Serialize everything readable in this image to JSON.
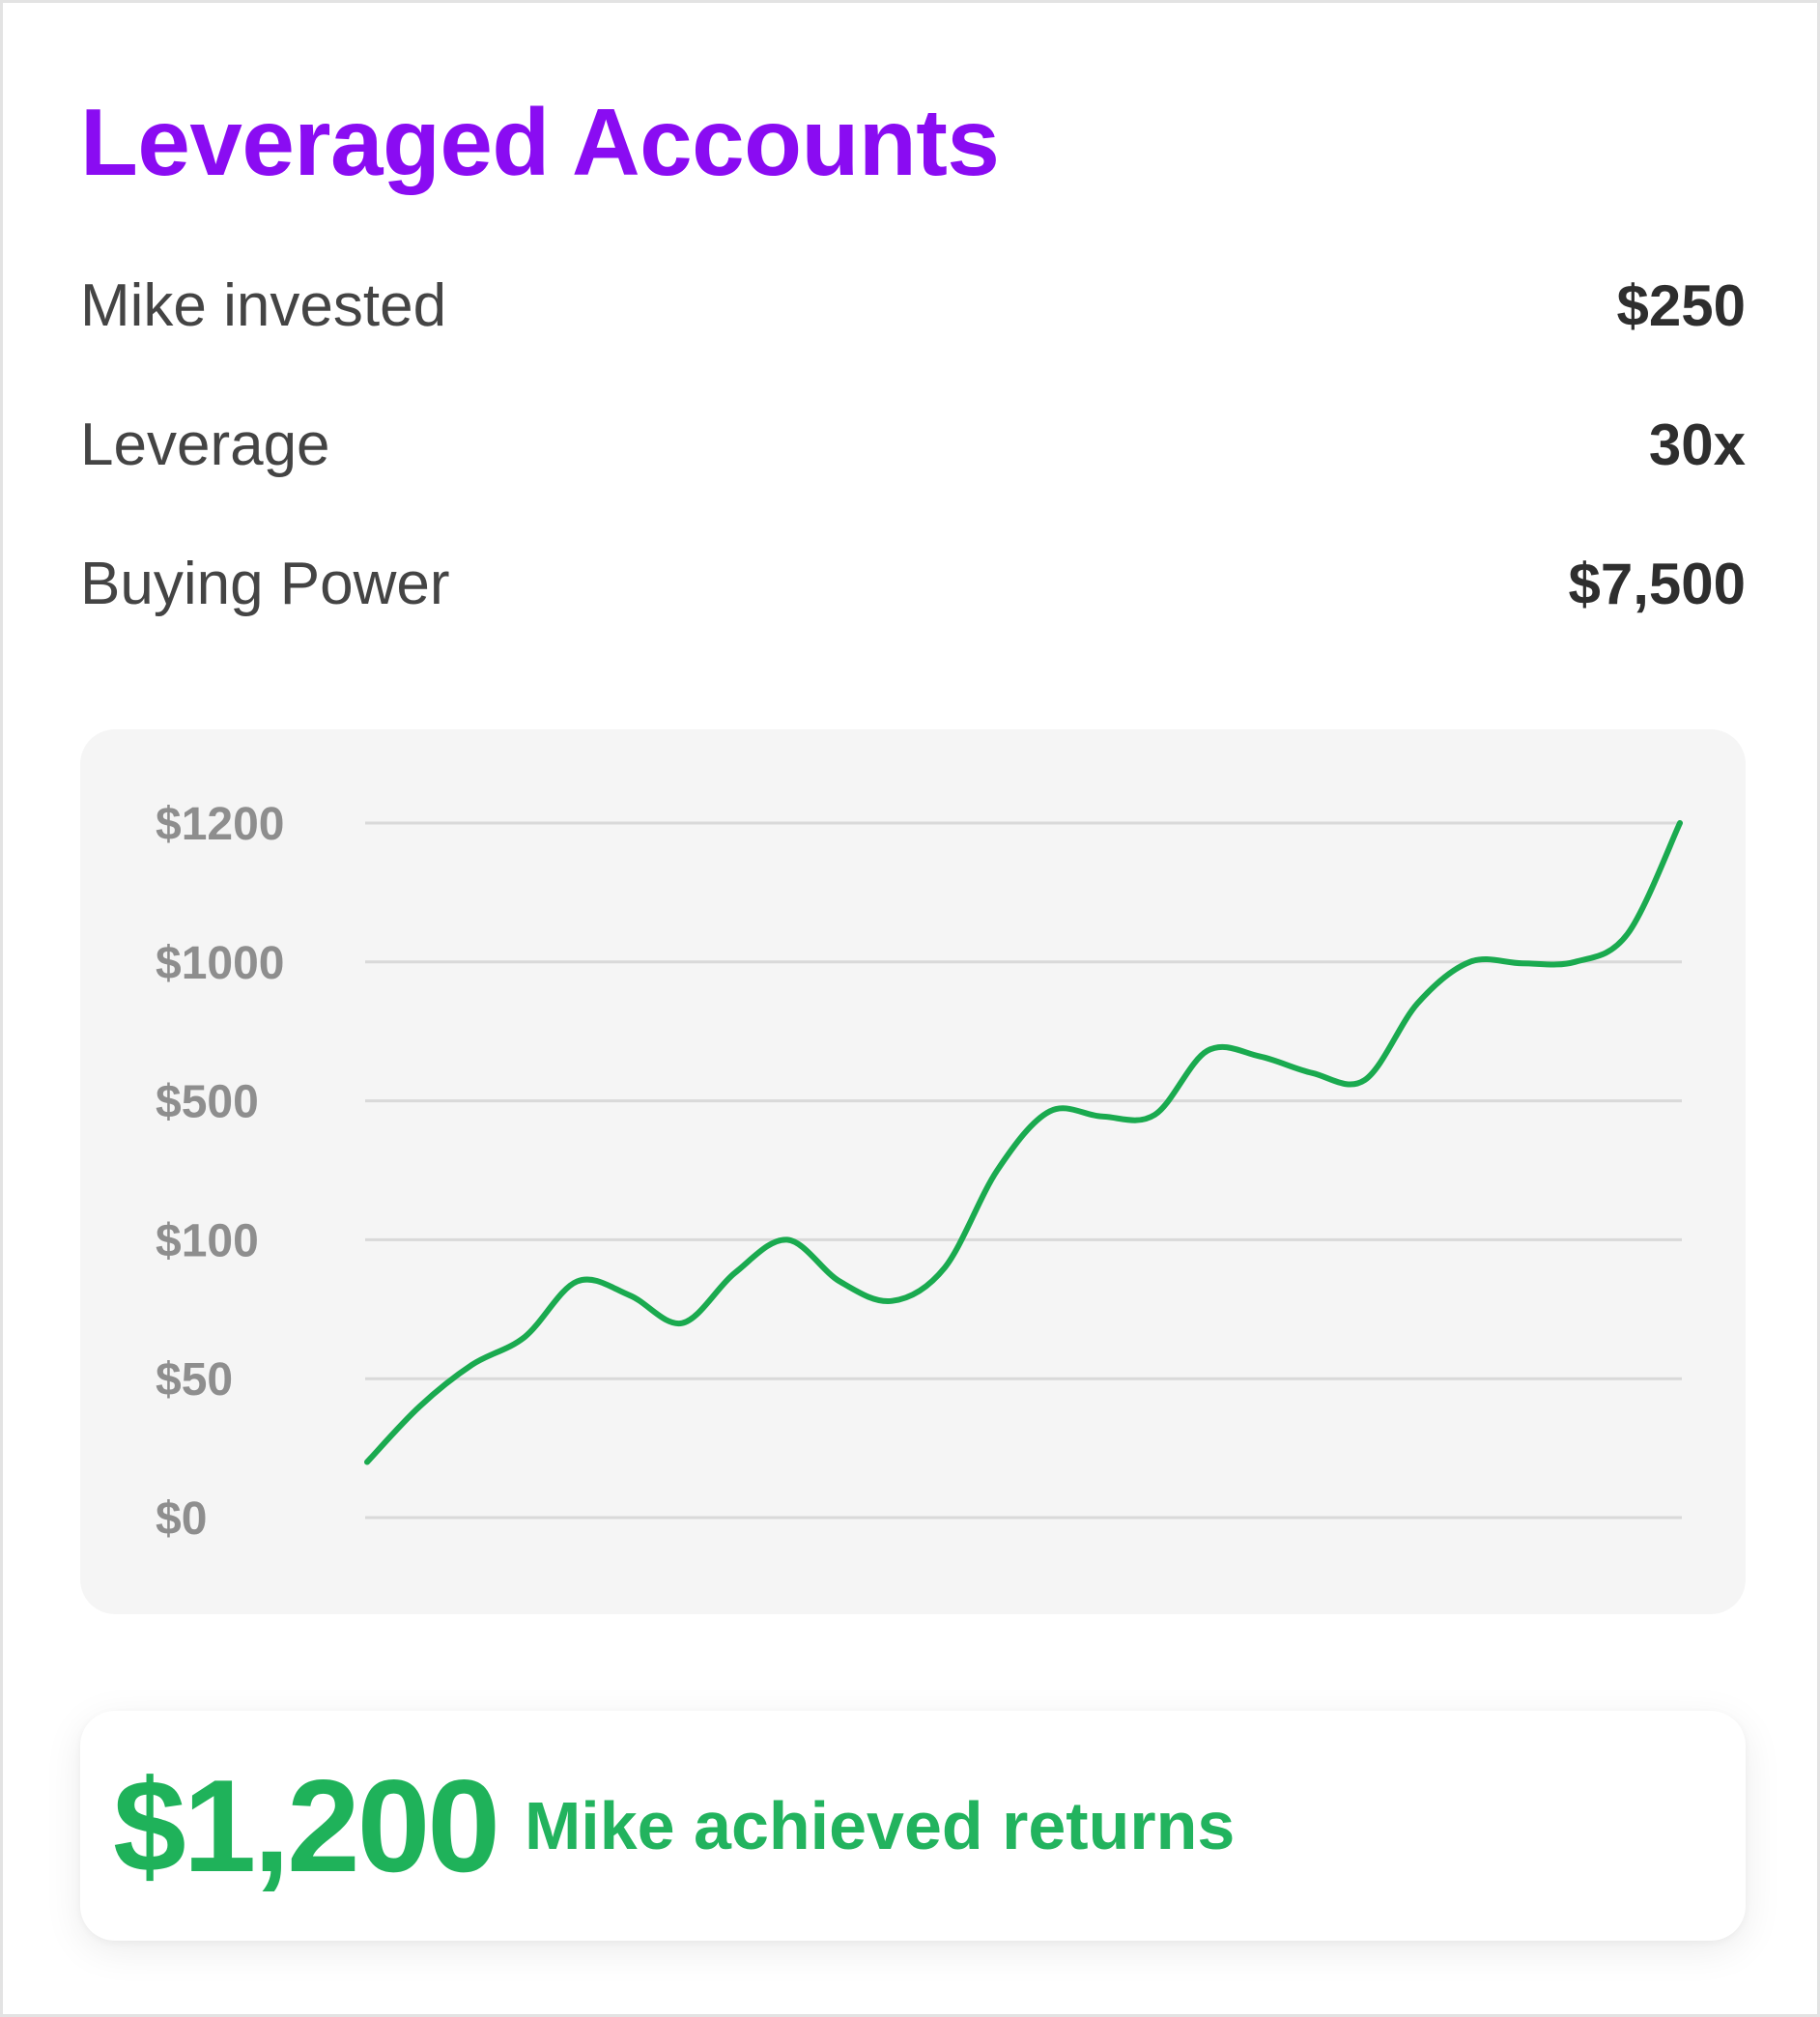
{
  "header": {
    "title": "Leveraged Accounts"
  },
  "stats": [
    {
      "label": "Mike invested",
      "value": "$250"
    },
    {
      "label": "Leverage",
      "value": "30x"
    },
    {
      "label": "Buying Power",
      "value": "$7,500"
    }
  ],
  "colors": {
    "title": "#8a0cf2",
    "accent_green": "#1fb25a",
    "line": "#1aaa4f"
  },
  "chart_data": {
    "type": "line",
    "title": "",
    "xlabel": "",
    "ylabel": "",
    "grid": true,
    "y_ticks": [
      "$0",
      "$50",
      "$100",
      "$500",
      "$1000",
      "$1200"
    ],
    "y_scale": "categorical-step",
    "series": [
      {
        "values": [
          20,
          40,
          55,
          65,
          85,
          80,
          70,
          88,
          100,
          85,
          78,
          90,
          300,
          470,
          455,
          460,
          680,
          660,
          600,
          575,
          850,
          1000,
          995,
          1000,
          1040,
          1200
        ]
      }
    ]
  },
  "result": {
    "amount": "$1,200",
    "caption": "Mike achieved returns"
  }
}
